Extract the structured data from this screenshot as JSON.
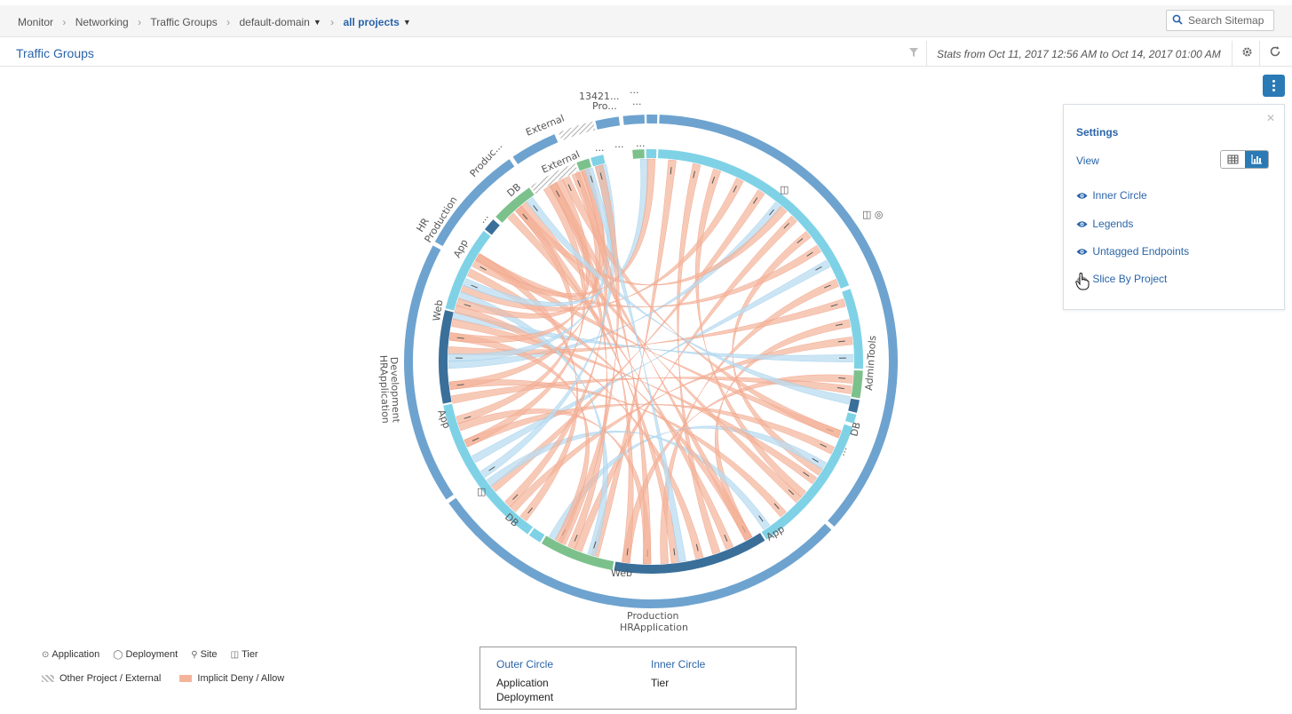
{
  "breadcrumb": {
    "items": [
      "Monitor",
      "Networking",
      "Traffic Groups",
      "default-domain"
    ],
    "active": "all projects",
    "search_placeholder": "Search Sitemap"
  },
  "header": {
    "title": "Traffic Groups",
    "stats": "Stats from Oct 11, 2017 12:56 AM to Oct 14, 2017 01:00 AM"
  },
  "settings": {
    "title": "Settings",
    "view_label": "View",
    "options": [
      "Inner Circle",
      "Legends",
      "Untagged Endpoints",
      "Slice By Project"
    ]
  },
  "legend": {
    "application": "Application",
    "deployment": "Deployment",
    "site": "Site",
    "tier": "Tier",
    "other_project": "Other Project / External",
    "implicit": "Implicit Deny / Allow"
  },
  "circles_box": {
    "outer_title": "Outer Circle",
    "outer_lines": [
      "Application",
      "Deployment"
    ],
    "inner_title": "Inner Circle",
    "inner_lines": [
      "Tier"
    ]
  },
  "chord_labels": {
    "outer_top1": "13421...",
    "outer_top1b": "Pro...",
    "outer_top2": "...",
    "outer_top2b": "...",
    "external_outer": "External",
    "product_outer": "Produc...",
    "hr": "HR",
    "production_left": "Production",
    "development": "Development",
    "hrapplication_left": "HRApplication",
    "production_bottom": "Production",
    "hrapplication_bottom": "HRApplication",
    "external_inner": "External",
    "dots": "...",
    "db": "DB",
    "app": "App",
    "web": "Web",
    "admintools": "AdminTools"
  },
  "colors": {
    "outer": "#6ea3cf",
    "inner_tier": "#7fd2e6",
    "inner_dark": "#3a6f9a",
    "inner_green": "#7cc18c",
    "chord_deny": "#f4b49a",
    "chord_allow": "#b9dcf2",
    "accent": "#2a7ab5"
  }
}
